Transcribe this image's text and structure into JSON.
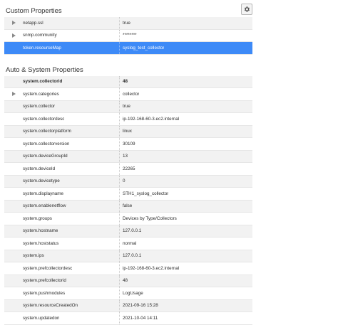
{
  "custom": {
    "title": "Custom Properties",
    "rows": [
      {
        "key": "netapp.ssl",
        "value": "true",
        "expandable": true
      },
      {
        "key": "snmp.community",
        "value": "********",
        "expandable": true
      },
      {
        "key": "token.resourceMap",
        "value": "syslog_test_collector",
        "expandable": false,
        "selected": true
      }
    ]
  },
  "system": {
    "title": "Auto & System Properties",
    "rows": [
      {
        "key": "system.collectorid",
        "value": "48",
        "bold": true
      },
      {
        "key": "system.categories",
        "value": "collector",
        "expandable": true
      },
      {
        "key": "system.collector",
        "value": "true"
      },
      {
        "key": "system.collectordesc",
        "value": "ip-192-168-60-3.ec2.internal"
      },
      {
        "key": "system.collectorplatform",
        "value": "linux"
      },
      {
        "key": "system.collectorversion",
        "value": "30109"
      },
      {
        "key": "system.deviceGroupId",
        "value": "13"
      },
      {
        "key": "system.deviceId",
        "value": "22265"
      },
      {
        "key": "system.devicetype",
        "value": "0"
      },
      {
        "key": "system.displayname",
        "value": "STH1_syslog_collector"
      },
      {
        "key": "system.enablenetflow",
        "value": "false"
      },
      {
        "key": "system.groups",
        "value": "Devices by Type/Collectors"
      },
      {
        "key": "system.hostname",
        "value": "127.0.0.1"
      },
      {
        "key": "system.hoststatus",
        "value": "normal"
      },
      {
        "key": "system.ips",
        "value": "127.0.0.1"
      },
      {
        "key": "system.prefcollectordesc",
        "value": "ip-192-168-60-3.ec2.internal"
      },
      {
        "key": "system.prefcollectorid",
        "value": "48"
      },
      {
        "key": "system.pushmodules",
        "value": "LogUsage"
      },
      {
        "key": "system.resourceCreatedOn",
        "value": "2021-09-16 15:28"
      },
      {
        "key": "system.updatedon",
        "value": "2021-10-04 14:11"
      }
    ]
  },
  "icons": {
    "settings": "gear-icon",
    "expand": "triangle-right-icon"
  },
  "colors": {
    "selected_row": "#3d8af7",
    "alt_row": "#f2f2f2"
  }
}
